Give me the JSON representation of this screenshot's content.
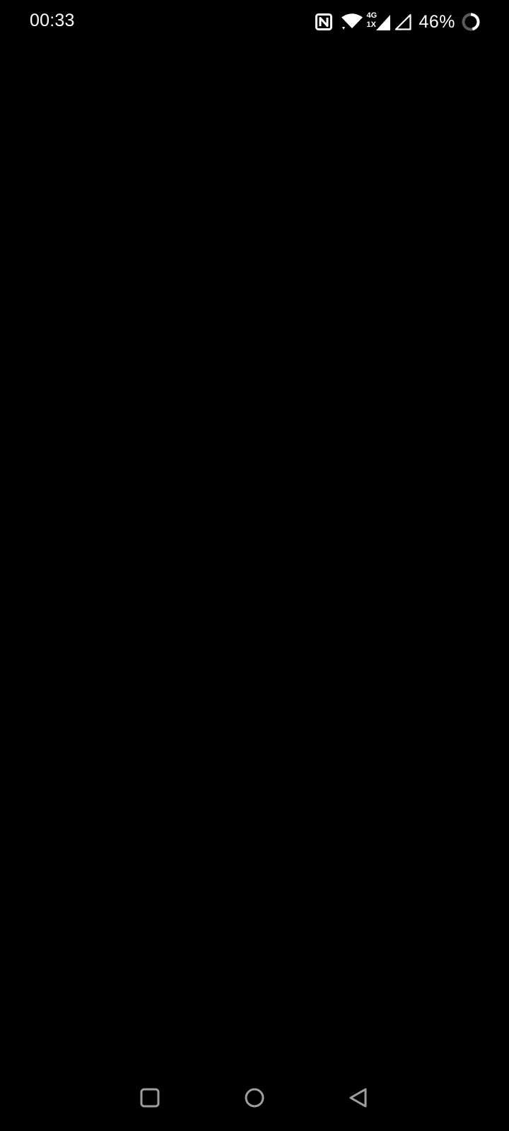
{
  "status_bar": {
    "time": "00:33",
    "network_tech": "4G",
    "network_mode": "1X",
    "battery_percent": "46%",
    "battery_level": 0.46,
    "icons": [
      "nfc-icon",
      "wifi-icon",
      "cellular-signal-icon",
      "cellular-signal-empty-icon",
      "battery-ring-icon"
    ]
  },
  "navigation_bar": {
    "buttons": [
      "recents",
      "home",
      "back"
    ],
    "icon_color": "#9e9e9e"
  },
  "theme": {
    "background": "#000000",
    "foreground": "#ffffff"
  }
}
